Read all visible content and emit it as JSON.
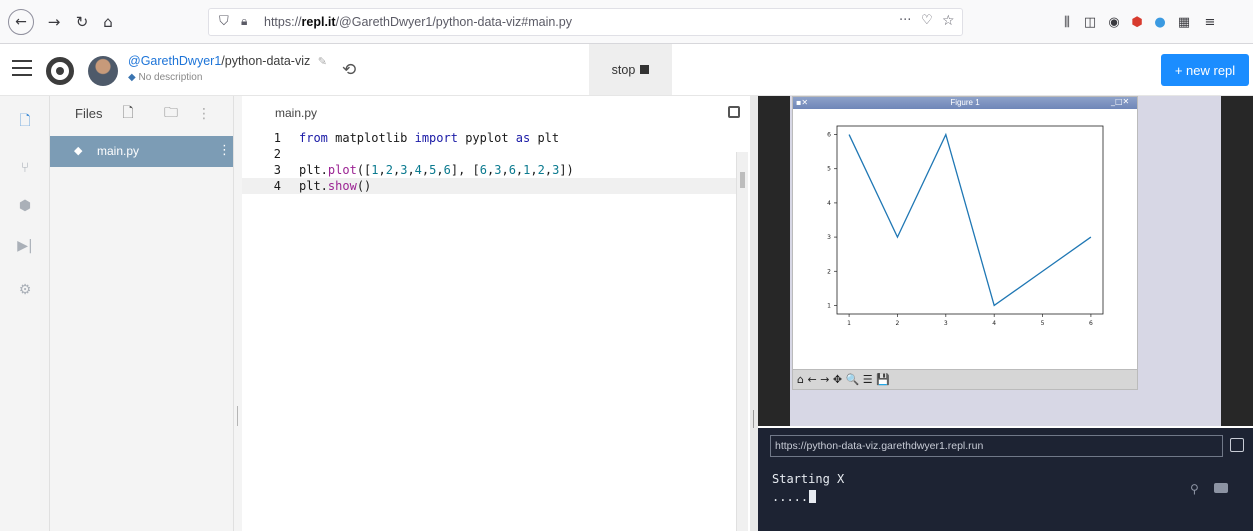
{
  "browser": {
    "url_prefix": "https://",
    "url_domain": "repl.it",
    "url_path": "/@GarethDwyer1/python-data-viz#main.py",
    "back_icon": "arrow-left",
    "forward_icon": "arrow-right",
    "reload_icon": "reload",
    "home_icon": "home"
  },
  "header": {
    "owner": "@GarethDwyer1",
    "repl_name": "/python-data-viz",
    "description": "No description",
    "stop_label": "stop",
    "new_repl_label": "+ new repl"
  },
  "files": {
    "title": "Files",
    "items": [
      {
        "name": "main.py",
        "selected": true
      }
    ]
  },
  "editor": {
    "tab": "main.py",
    "lines": [
      {
        "num": "1",
        "tokens": [
          {
            "t": "from",
            "c": "kw"
          },
          {
            "t": " matplotlib ",
            "c": ""
          },
          {
            "t": "import",
            "c": "kw"
          },
          {
            "t": " pyplot ",
            "c": ""
          },
          {
            "t": "as",
            "c": "kw"
          },
          {
            "t": " plt",
            "c": ""
          }
        ]
      },
      {
        "num": "2",
        "tokens": []
      },
      {
        "num": "3",
        "tokens": [
          {
            "t": "plt.",
            "c": ""
          },
          {
            "t": "plot",
            "c": "fn"
          },
          {
            "t": "([",
            "c": ""
          },
          {
            "t": "1",
            "c": "num"
          },
          {
            "t": ",",
            "c": ""
          },
          {
            "t": "2",
            "c": "num"
          },
          {
            "t": ",",
            "c": ""
          },
          {
            "t": "3",
            "c": "num"
          },
          {
            "t": ",",
            "c": ""
          },
          {
            "t": "4",
            "c": "num"
          },
          {
            "t": ",",
            "c": ""
          },
          {
            "t": "5",
            "c": "num"
          },
          {
            "t": ",",
            "c": ""
          },
          {
            "t": "6",
            "c": "num"
          },
          {
            "t": "], [",
            "c": ""
          },
          {
            "t": "6",
            "c": "num"
          },
          {
            "t": ",",
            "c": ""
          },
          {
            "t": "3",
            "c": "num"
          },
          {
            "t": ",",
            "c": ""
          },
          {
            "t": "6",
            "c": "num"
          },
          {
            "t": ",",
            "c": ""
          },
          {
            "t": "1",
            "c": "num"
          },
          {
            "t": ",",
            "c": ""
          },
          {
            "t": "2",
            "c": "num"
          },
          {
            "t": ",",
            "c": ""
          },
          {
            "t": "3",
            "c": "num"
          },
          {
            "t": "])",
            "c": ""
          }
        ]
      },
      {
        "num": "4",
        "tokens": [
          {
            "t": "plt.",
            "c": ""
          },
          {
            "t": "show",
            "c": "fn"
          },
          {
            "t": "()",
            "c": ""
          }
        ]
      }
    ]
  },
  "figure": {
    "window_title": "Figure 1",
    "toolbar_glyphs": "⌂ ← → ✥ 🔍 ☰ 💾"
  },
  "chart_data": {
    "type": "line",
    "x": [
      1,
      2,
      3,
      4,
      5,
      6
    ],
    "series": [
      {
        "values": [
          6,
          3,
          6,
          1,
          2,
          3
        ]
      }
    ],
    "xticks": [
      "1",
      "2",
      "3",
      "4",
      "5",
      "6"
    ],
    "yticks": [
      "1",
      "2",
      "3",
      "4",
      "5",
      "6"
    ],
    "xlim": [
      0.75,
      6.25
    ],
    "ylim": [
      0.75,
      6.25
    ],
    "line_color": "#1f77b4",
    "title": "",
    "xlabel": "",
    "ylabel": "",
    "grid": false
  },
  "console": {
    "web_url": "https://python-data-viz.garethdwyer1.repl.run",
    "line1": "Starting X",
    "line2": "....."
  },
  "colors": {
    "accent": "#1b8dff",
    "file_selected": "#7c9cb5",
    "console_bg": "#1d2333"
  }
}
